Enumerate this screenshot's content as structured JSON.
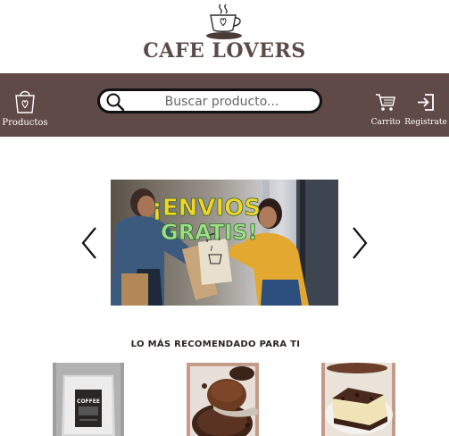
{
  "brand": {
    "name": "CAFE LOVERS"
  },
  "nav": {
    "products_label": "Productos",
    "cart_label": "Carrito",
    "register_label": "Registrate"
  },
  "search": {
    "placeholder": "Buscar producto..."
  },
  "banner": {
    "line1": "¡ENVIOS",
    "line2": "GRATIS!"
  },
  "recommended": {
    "title": "LO MÁS RECOMENDADO PARA TI",
    "products": [
      {
        "name": "coffee-bag",
        "bag_label": "COFFEE"
      },
      {
        "name": "ground-coffee"
      },
      {
        "name": "cheesecake"
      }
    ]
  },
  "colors": {
    "navbar": "#5f4a48",
    "brand_text": "#5c4a48",
    "product_frame": "#b08f83"
  }
}
